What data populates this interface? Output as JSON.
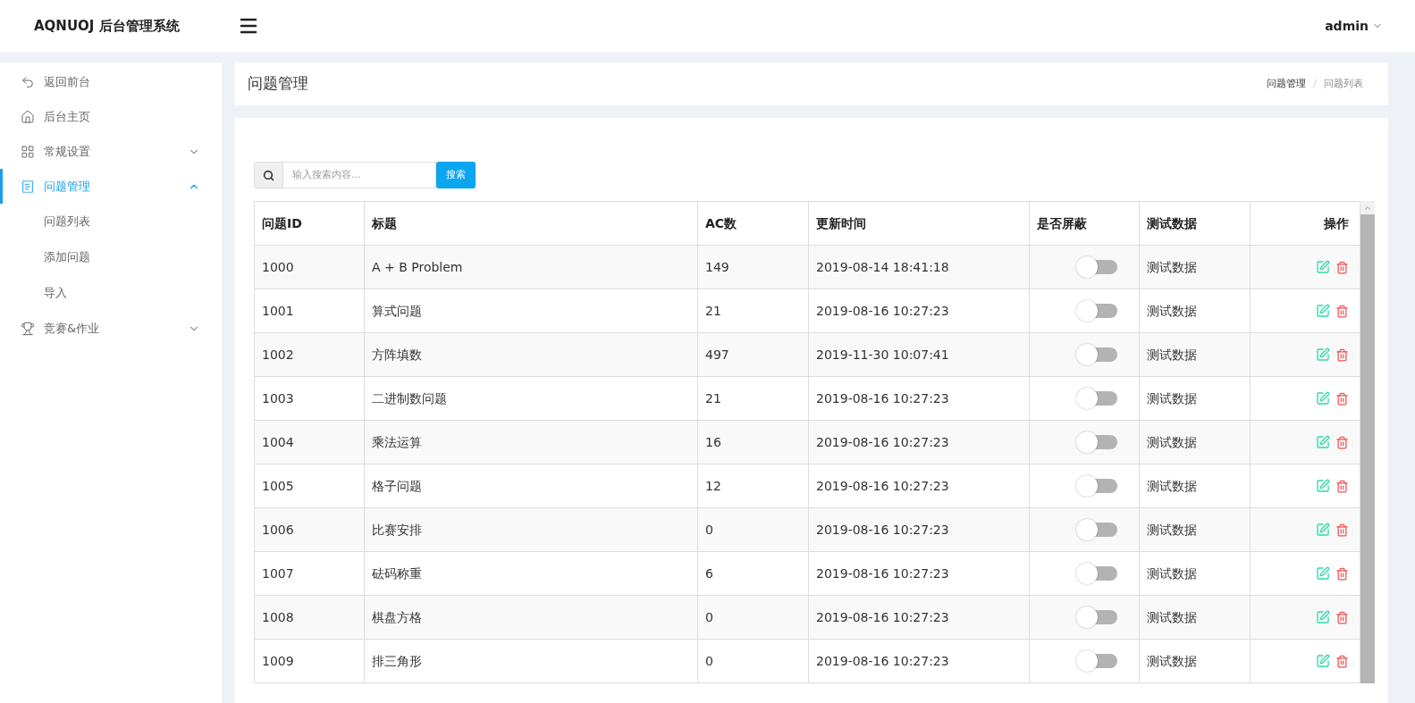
{
  "header": {
    "brand": "AQNUOJ 后台管理系统",
    "user": "admin"
  },
  "sidebar": {
    "items": [
      {
        "label": "返回前台",
        "kind": "return",
        "selected": false
      },
      {
        "label": "后台主页",
        "kind": "home",
        "selected": false
      },
      {
        "label": "常规设置",
        "kind": "grid",
        "selected": false,
        "expanded": false
      },
      {
        "label": "问题管理",
        "kind": "doc",
        "selected": true,
        "expanded": true,
        "children": [
          {
            "label": "问题列表",
            "selected": false
          },
          {
            "label": "添加问题",
            "selected": false
          },
          {
            "label": "导入",
            "selected": false
          }
        ]
      },
      {
        "label": "竞赛&作业",
        "kind": "trophy",
        "selected": false,
        "expanded": false
      }
    ]
  },
  "page": {
    "title": "问题管理",
    "breadcrumb": [
      "问题管理",
      "问题列表"
    ],
    "breadcrumb_separator": "/"
  },
  "search": {
    "placeholder": "输入搜索内容...",
    "button": "搜索"
  },
  "table": {
    "columns": [
      "问题ID",
      "标题",
      "AC数",
      "更新时间",
      "是否屏蔽",
      "测试数据",
      "操作"
    ],
    "rows": [
      {
        "id": "1000",
        "title": "A + B Problem",
        "ac": "149",
        "updated": "2019-08-14 18:41:18",
        "blocked": false,
        "data": "测试数据"
      },
      {
        "id": "1001",
        "title": "算式问题",
        "ac": "21",
        "updated": "2019-08-16 10:27:23",
        "blocked": false,
        "data": "测试数据"
      },
      {
        "id": "1002",
        "title": "方阵填数",
        "ac": "497",
        "updated": "2019-11-30 10:07:41",
        "blocked": false,
        "data": "测试数据"
      },
      {
        "id": "1003",
        "title": "二进制数问题",
        "ac": "21",
        "updated": "2019-08-16 10:27:23",
        "blocked": false,
        "data": "测试数据"
      },
      {
        "id": "1004",
        "title": "乘法运算",
        "ac": "16",
        "updated": "2019-08-16 10:27:23",
        "blocked": false,
        "data": "测试数据"
      },
      {
        "id": "1005",
        "title": "格子问题",
        "ac": "12",
        "updated": "2019-08-16 10:27:23",
        "blocked": false,
        "data": "测试数据"
      },
      {
        "id": "1006",
        "title": "比赛安排",
        "ac": "0",
        "updated": "2019-08-16 10:27:23",
        "blocked": false,
        "data": "测试数据"
      },
      {
        "id": "1007",
        "title": "砝码称重",
        "ac": "6",
        "updated": "2019-08-16 10:27:23",
        "blocked": false,
        "data": "测试数据"
      },
      {
        "id": "1008",
        "title": "棋盘方格",
        "ac": "0",
        "updated": "2019-08-16 10:27:23",
        "blocked": false,
        "data": "测试数据"
      },
      {
        "id": "1009",
        "title": "排三角形",
        "ac": "0",
        "updated": "2019-08-16 10:27:23",
        "blocked": false,
        "data": "测试数据"
      }
    ]
  }
}
